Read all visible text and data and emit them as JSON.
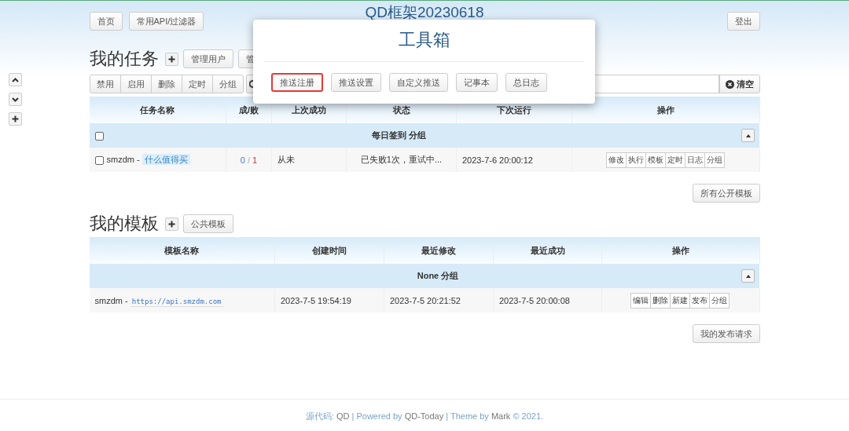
{
  "header": {
    "buttons": [
      "首页",
      "常用API/过滤器"
    ],
    "title": "QD框架20230618",
    "logout": "登出"
  },
  "tasks": {
    "title": "我的任务",
    "buttons": [
      "管理用户",
      "管"
    ],
    "toolbar": [
      "禁用",
      "启用",
      "删除",
      "定时",
      "分组"
    ],
    "clear": "清空",
    "columns": [
      "任务名称",
      "成/败",
      "上次成功",
      "状态",
      "下次运行",
      "操作"
    ],
    "groups": [
      {
        "name": "每日签到 分组",
        "checked": false,
        "rows": [
          {
            "checked": false,
            "name": "smzdm -",
            "tag": "什么值得买",
            "success": "0",
            "divider": "/",
            "fail": "1",
            "last": "从未",
            "status": "已失败1次，重试中...",
            "next": "2023-7-6 20:00:12",
            "actions": [
              "修改",
              "执行",
              "模板",
              "定时",
              "日志",
              "分组"
            ]
          }
        ]
      }
    ],
    "more_button": "所有公开模板"
  },
  "templates": {
    "title": "我的模板",
    "buttons": [
      "公共模板"
    ],
    "columns": [
      "模板名称",
      "创建时间",
      "最近修改",
      "最近成功",
      "操作"
    ],
    "groups": [
      {
        "name": "None 分组",
        "rows": [
          {
            "name": "smzdm -",
            "link": "https://api.smzdm.com",
            "created": "2023-7-5 19:54:19",
            "modified": "2023-7-5 20:21:52",
            "succeeded": "2023-7-5 20:00:08",
            "actions": [
              "编辑",
              "删除",
              "新建",
              "发布",
              "分组"
            ]
          }
        ]
      }
    ],
    "more_button": "我的发布请求"
  },
  "toolbox": {
    "title": "工具箱",
    "buttons": [
      {
        "label": "推送注册",
        "highlighted": true
      },
      {
        "label": "推送设置",
        "highlighted": false
      },
      {
        "label": "自定义推送",
        "highlighted": false
      },
      {
        "label": "记事本",
        "highlighted": false
      },
      {
        "label": "总日志",
        "highlighted": false
      }
    ]
  },
  "footer": [
    {
      "kind": "text",
      "text": "源代码:"
    },
    {
      "kind": "link",
      "text": "QD"
    },
    {
      "kind": "text",
      "text": "| Powered by"
    },
    {
      "kind": "link",
      "text": "QD-Today"
    },
    {
      "kind": "text",
      "text": "| Theme by"
    },
    {
      "kind": "link",
      "text": "Mark"
    },
    {
      "kind": "text",
      "text": "© 2021."
    }
  ]
}
